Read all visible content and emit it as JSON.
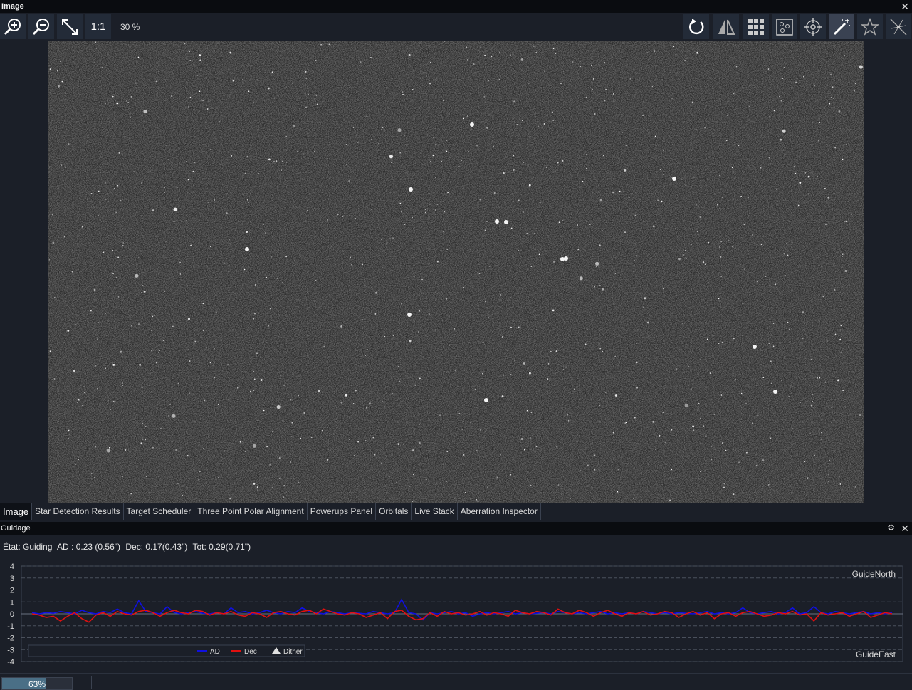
{
  "image_panel": {
    "title": "Image",
    "zoom_level": "30 %",
    "one_to_one_label": "1:1",
    "toolbar_left": [
      "zoom-in-icon",
      "zoom-out-icon",
      "fit-to-screen-icon"
    ],
    "toolbar_right": [
      "auto-stretch-icon",
      "flip-icon",
      "grid-overlay-icon",
      "star-detection-icon",
      "crosshair-icon",
      "magic-wand-icon",
      "star-annotation-icon",
      "star-spikes-icon"
    ]
  },
  "tabs": [
    {
      "label": "Image",
      "active": true
    },
    {
      "label": "Star Detection Results",
      "active": false
    },
    {
      "label": "Target Scheduler",
      "active": false
    },
    {
      "label": "Three Point Polar Alignment",
      "active": false
    },
    {
      "label": "Powerups Panel",
      "active": false
    },
    {
      "label": "Orbitals",
      "active": false
    },
    {
      "label": "Live Stack",
      "active": false
    },
    {
      "label": "Aberration Inspector",
      "active": false
    }
  ],
  "guiding": {
    "title": "Guidage",
    "status_label": "État: Guiding",
    "ra": "AD : 0.23 (0.56\")",
    "dec": "Dec: 0.17(0.43\")",
    "tot": "Tot: 0.29(0.71\")"
  },
  "chart_data": {
    "type": "line",
    "ylim": [
      -4,
      4
    ],
    "y_ticks": [
      "4",
      "3",
      "2",
      "1",
      "0",
      "-1",
      "-2",
      "-3",
      "-4"
    ],
    "label_top": "GuideNorth",
    "label_bottom": "GuideEast",
    "legend": [
      "AD",
      "Dec",
      "Dither"
    ],
    "colors": {
      "AD": "#1010e0",
      "Dec": "#e01010",
      "Dither": "#e0e0e0"
    },
    "series": [
      {
        "name": "AD",
        "values": [
          0.1,
          0.0,
          0.1,
          0.05,
          0.2,
          0.1,
          0.0,
          0.3,
          0.1,
          0.0,
          0.2,
          0.1,
          0.4,
          0.1,
          0.0,
          1.1,
          0.2,
          0.1,
          0.0,
          0.6,
          0.1,
          0.0,
          0.1,
          0.2,
          0.05,
          0.0,
          0.1,
          0.0,
          0.5,
          0.1,
          0.2,
          0.0,
          0.1,
          0.3,
          0.1,
          0.0,
          0.2,
          0.1,
          0.5,
          0.2,
          0.1,
          0.0,
          0.2,
          0.1,
          0.0,
          0.1,
          0.05,
          0.0,
          0.2,
          0.1,
          0.0,
          0.1,
          1.2,
          0.1,
          0.0,
          -0.5,
          0.1,
          0.0,
          0.1,
          0.2,
          0.0,
          0.1,
          -0.2,
          0.0,
          0.1,
          0.0,
          0.1,
          0.2,
          0.0,
          0.1,
          0.0,
          0.05,
          0.1,
          0.0,
          0.2,
          0.1,
          0.0,
          0.1,
          0.0,
          0.1,
          0.2,
          0.0,
          0.1,
          0.0,
          0.1,
          0.0,
          0.2,
          0.1,
          0.0,
          0.1,
          0.0,
          0.1,
          0.05,
          0.0,
          0.1,
          0.2,
          0.0,
          0.1,
          0.0,
          0.1,
          0.5,
          0.1,
          0.0,
          0.1,
          0.2,
          0.0,
          0.1,
          0.5,
          0.0,
          0.1,
          0.6,
          0.1,
          0.0,
          0.2,
          0.1,
          0.0,
          0.1,
          0.2,
          0.0,
          0.1,
          0.0,
          0.1
        ]
      },
      {
        "name": "Dec",
        "values": [
          0.0,
          -0.1,
          -0.3,
          -0.2,
          -0.6,
          -0.2,
          0.1,
          -0.4,
          -0.7,
          -0.1,
          0.1,
          -0.2,
          0.2,
          0.0,
          -0.1,
          0.2,
          0.3,
          0.1,
          -0.2,
          0.1,
          0.3,
          0.1,
          0.0,
          0.3,
          0.2,
          -0.1,
          0.1,
          0.0,
          0.2,
          -0.1,
          -0.2,
          0.1,
          0.0,
          -0.3,
          0.1,
          0.2,
          0.0,
          -0.1,
          0.2,
          0.3,
          0.0,
          0.4,
          0.2,
          0.0,
          -0.1,
          0.1,
          0.0,
          -0.3,
          -0.1,
          0.1,
          -0.4,
          0.2,
          0.3,
          -0.2,
          -0.5,
          -0.4,
          0.1,
          -0.2,
          0.2,
          0.0,
          0.1,
          -0.1,
          0.0,
          0.2,
          -0.1,
          0.1,
          0.0,
          -0.2,
          0.3,
          0.1,
          0.0,
          0.2,
          0.1,
          -0.1,
          0.4,
          0.1,
          0.0,
          0.3,
          0.1,
          -0.2,
          0.1,
          0.3,
          0.0,
          -0.2,
          0.1,
          0.0,
          0.2,
          -0.1,
          0.0,
          0.2,
          0.1,
          -0.3,
          0.0,
          0.2,
          -0.1,
          0.1,
          -0.4,
          0.0,
          0.1,
          -0.2,
          0.1,
          0.2,
          0.0,
          -0.2,
          -0.1,
          0.1,
          0.0,
          0.2,
          -0.1,
          0.0,
          -0.6,
          0.1,
          -0.1,
          0.0,
          0.1,
          -0.2,
          0.0,
          0.2,
          -0.3,
          -0.1,
          0.1,
          0.0
        ]
      }
    ]
  },
  "status_bar": {
    "progress_text": "63%",
    "progress_fraction": 0.63
  }
}
